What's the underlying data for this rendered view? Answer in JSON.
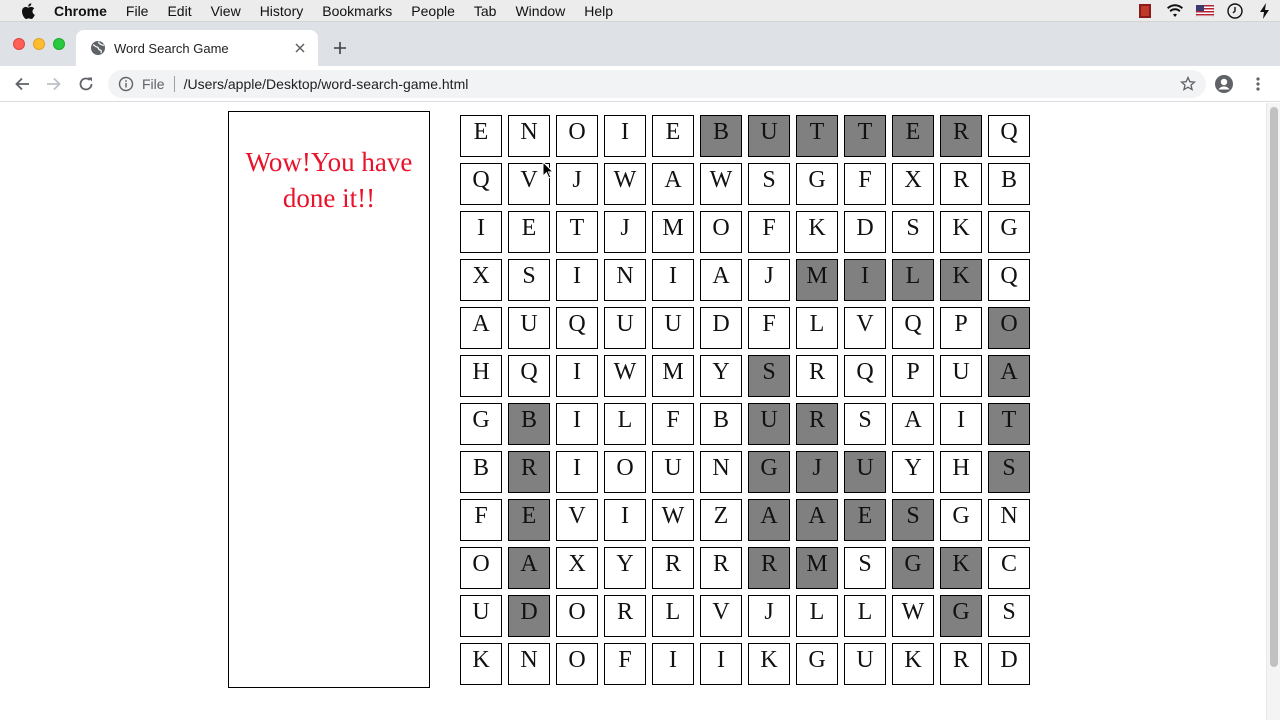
{
  "menubar": {
    "app": "Chrome",
    "items": [
      "File",
      "Edit",
      "View",
      "History",
      "Bookmarks",
      "People",
      "Tab",
      "Window",
      "Help"
    ]
  },
  "tab": {
    "title": "Word Search Game"
  },
  "toolbar": {
    "scheme_label": "File",
    "url": "/Users/apple/Desktop/word-search-game.html"
  },
  "panel": {
    "message": "Wow!You have done it!!"
  },
  "grid": {
    "rows": [
      [
        "E",
        "N",
        "O",
        "I",
        "E",
        "B",
        "U",
        "T",
        "T",
        "E",
        "R",
        "Q"
      ],
      [
        "Q",
        "V",
        "J",
        "W",
        "A",
        "W",
        "S",
        "G",
        "F",
        "X",
        "R",
        "B"
      ],
      [
        "I",
        "E",
        "T",
        "J",
        "M",
        "O",
        "F",
        "K",
        "D",
        "S",
        "K",
        "G"
      ],
      [
        "X",
        "S",
        "I",
        "N",
        "I",
        "A",
        "J",
        "M",
        "I",
        "L",
        "K",
        "Q"
      ],
      [
        "A",
        "U",
        "Q",
        "U",
        "U",
        "D",
        "F",
        "L",
        "V",
        "Q",
        "P",
        "O"
      ],
      [
        "H",
        "Q",
        "I",
        "W",
        "M",
        "Y",
        "S",
        "R",
        "Q",
        "P",
        "U",
        "A"
      ],
      [
        "G",
        "B",
        "I",
        "L",
        "F",
        "B",
        "U",
        "R",
        "S",
        "A",
        "I",
        "T"
      ],
      [
        "B",
        "R",
        "I",
        "O",
        "U",
        "N",
        "G",
        "J",
        "U",
        "Y",
        "H",
        "S"
      ],
      [
        "F",
        "E",
        "V",
        "I",
        "W",
        "Z",
        "A",
        "A",
        "E",
        "S",
        "G",
        "N"
      ],
      [
        "O",
        "A",
        "X",
        "Y",
        "R",
        "R",
        "R",
        "M",
        "S",
        "G",
        "K",
        "C"
      ],
      [
        "U",
        "D",
        "O",
        "R",
        "L",
        "V",
        "J",
        "L",
        "L",
        "W",
        "G",
        "S"
      ],
      [
        "K",
        "N",
        "O",
        "F",
        "I",
        "I",
        "K",
        "G",
        "U",
        "K",
        "R",
        "D"
      ]
    ],
    "highlighted": [
      [
        0,
        5
      ],
      [
        0,
        6
      ],
      [
        0,
        7
      ],
      [
        0,
        8
      ],
      [
        0,
        9
      ],
      [
        0,
        10
      ],
      [
        3,
        7
      ],
      [
        3,
        8
      ],
      [
        3,
        9
      ],
      [
        3,
        10
      ],
      [
        4,
        11
      ],
      [
        5,
        11
      ],
      [
        6,
        11
      ],
      [
        7,
        11
      ],
      [
        5,
        6
      ],
      [
        6,
        6
      ],
      [
        7,
        6
      ],
      [
        8,
        6
      ],
      [
        9,
        6
      ],
      [
        6,
        1
      ],
      [
        7,
        1
      ],
      [
        8,
        1
      ],
      [
        9,
        1
      ],
      [
        10,
        1
      ],
      [
        6,
        7
      ],
      [
        7,
        8
      ],
      [
        8,
        9
      ],
      [
        9,
        10
      ],
      [
        10,
        10
      ],
      [
        7,
        7
      ],
      [
        8,
        7
      ],
      [
        9,
        7
      ],
      [
        8,
        8
      ],
      [
        9,
        9
      ]
    ]
  },
  "colors": {
    "highlight": "#808080",
    "message": "#e8122a"
  }
}
